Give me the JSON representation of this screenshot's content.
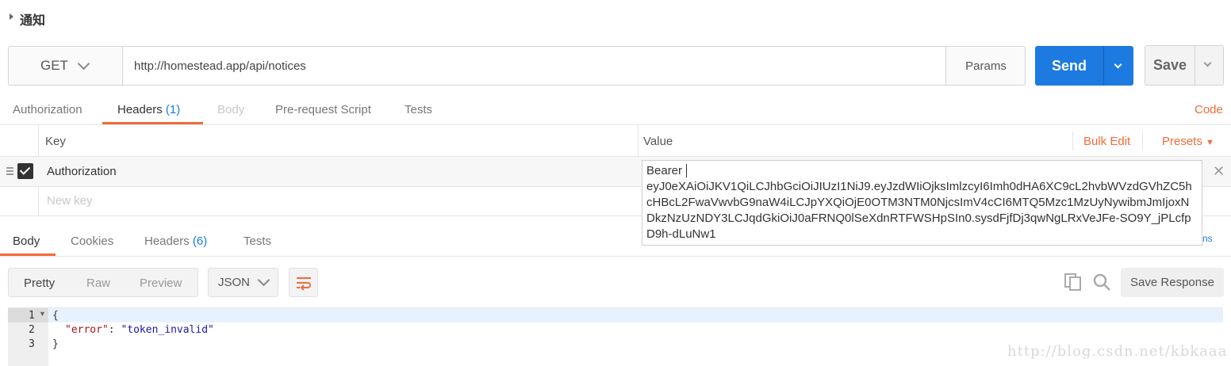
{
  "collection": {
    "title": "通知"
  },
  "request": {
    "method": "GET",
    "url": "http://homestead.app/api/notices",
    "params_label": "Params",
    "send_label": "Send",
    "save_label": "Save"
  },
  "request_tabs": {
    "items": [
      {
        "label": "Authorization"
      },
      {
        "label": "Headers",
        "count": "(1)"
      },
      {
        "label": "Body"
      },
      {
        "label": "Pre-request Script"
      },
      {
        "label": "Tests"
      }
    ],
    "code_label": "Code"
  },
  "headers_table": {
    "key_header": "Key",
    "value_header": "Value",
    "bulk_edit_label": "Bulk Edit",
    "presets_label": "Presets",
    "rows": [
      {
        "key": "Authorization",
        "enabled": true
      }
    ],
    "new_key_placeholder": "New key",
    "value_popup": {
      "line1": "Bearer",
      "token": "eyJ0eXAiOiJKV1QiLCJhbGciOiJIUzI1NiJ9.eyJzdWIiOjksImlzcyI6Imh0dHA6XC9cL2hvbWVzdGVhZC5hcHBcL2FwaVwvbG9naW4iLCJpYXQiOjE0OTM3NTM0NjcsImV4cCI6MTQ5Mzc1MzUyNywibmJmIjoxNDkzNzUzNDY3LCJqdGkiOiJ0aFRNQ0lSeXdnRTFWSHpSIn0.sysdFjfDj3qwNgLRxVeJFe-SO9Y_jPLcfpD9h-dLuNw1"
    },
    "partial_text": "ns"
  },
  "response_tabs": {
    "items": [
      {
        "label": "Body"
      },
      {
        "label": "Cookies"
      },
      {
        "label": "Headers",
        "count": "(6)"
      },
      {
        "label": "Tests"
      }
    ]
  },
  "response_toolbar": {
    "views": [
      "Pretty",
      "Raw",
      "Preview"
    ],
    "format": "JSON",
    "save_response_label": "Save Response"
  },
  "response_body": {
    "line_numbers": [
      "1",
      "2",
      "3"
    ],
    "open_brace": "{",
    "key": "\"error\"",
    "colon": ": ",
    "value": "\"token_invalid\"",
    "close_brace": "}"
  },
  "watermark": "http://blog.csdn.net/kbkaaa",
  "colors": {
    "accent": "#f26b3a",
    "send": "#1c7ae0"
  }
}
